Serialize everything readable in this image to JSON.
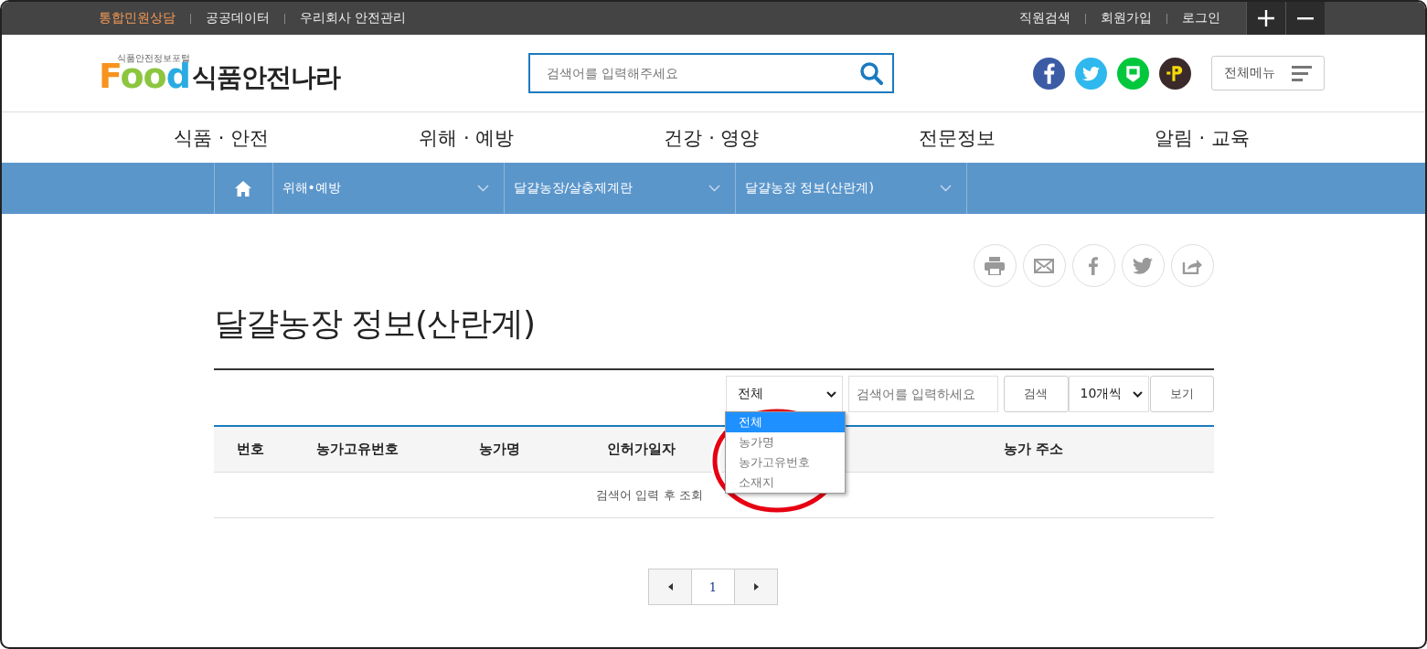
{
  "top_links": [
    {
      "label": "통합민원상담",
      "highlighted": true
    },
    {
      "label": "공공데이터",
      "highlighted": false
    },
    {
      "label": "우리회사 안전관리",
      "highlighted": false
    }
  ],
  "user_links": [
    "직원검색",
    "회원가입",
    "로그인"
  ],
  "logo": {
    "tagline": "식품안전정보포털",
    "wordmark": "Food",
    "name": "식품안전나라"
  },
  "search": {
    "placeholder": "검색어를 입력해주세요"
  },
  "all_menu": {
    "label": "전체메뉴"
  },
  "main_nav": [
    "식품 · 안전",
    "위해 · 예방",
    "건강 · 영양",
    "전문정보",
    "알림 · 교육"
  ],
  "breadcrumb": [
    "위해•예방",
    "달걀농장/살충제계란",
    "달걀농장 정보(산란계)"
  ],
  "page_title": "달걀농장 정보(산란계)",
  "filter": {
    "field": {
      "value": "전체",
      "expanded": true,
      "options": [
        {
          "label": "전체",
          "selected": true
        },
        {
          "label": "농가명",
          "selected": false
        },
        {
          "label": "농가고유번호",
          "selected": false
        },
        {
          "label": "소재지",
          "selected": false
        }
      ]
    },
    "search": {
      "placeholder": "검색어를 입력하세요"
    },
    "search_button": "검색",
    "page_size": "10개씩",
    "view_button": "보기"
  },
  "table": {
    "columns": [
      "번호",
      "농가고유번호",
      "농가명",
      "인허가일자",
      "농가 주소"
    ],
    "empty_message": "검색어 입력 후 조회"
  },
  "pagination": {
    "pages": [
      {
        "label": "1",
        "selected": true
      }
    ]
  }
}
